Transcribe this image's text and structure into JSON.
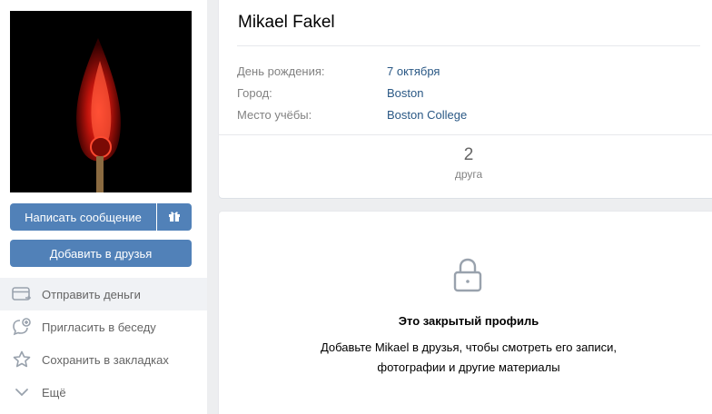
{
  "profile": {
    "name": "Mikael Fakel",
    "fields": [
      {
        "label": "День рождения:",
        "value": "7 октября"
      },
      {
        "label": "Город:",
        "value": "Boston"
      },
      {
        "label": "Место учёбы:",
        "value": "Boston College"
      }
    ],
    "friends_count": "2",
    "friends_caption": "друга"
  },
  "buttons": {
    "message": "Написать сообщение",
    "gift_icon": "gift-icon",
    "add_friend": "Добавить в друзья"
  },
  "actions": [
    {
      "label": "Отправить деньги",
      "icon": "money-transfer-icon"
    },
    {
      "label": "Пригласить в беседу",
      "icon": "invite-chat-icon"
    },
    {
      "label": "Сохранить в закладках",
      "icon": "star-icon"
    },
    {
      "label": "Ещё",
      "icon": "chevron-down-icon"
    }
  ],
  "private": {
    "icon": "lock-icon",
    "title": "Это закрытый профиль",
    "line1": "Добавьте Mikael в друзья, чтобы смотреть его записи,",
    "line2": "фотографии и другие материалы"
  },
  "colors": {
    "accent": "#5181b8",
    "link": "#2a5885",
    "background": "#edeef0"
  }
}
